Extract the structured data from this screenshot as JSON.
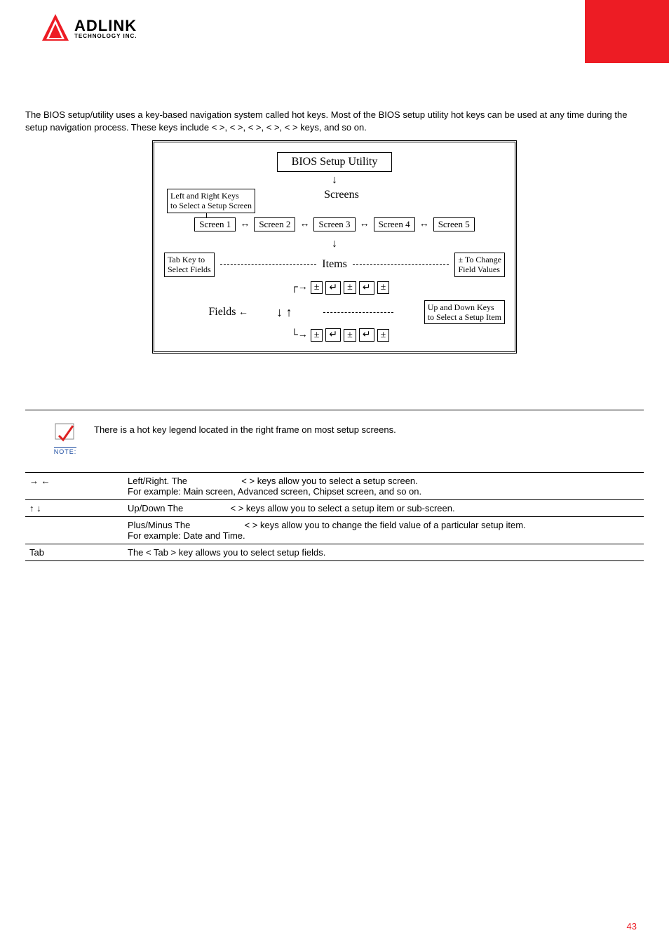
{
  "logo": {
    "line1": "ADLINK",
    "line2": "TECHNOLOGY INC."
  },
  "intro": "The BIOS setup/utility uses a key-based navigation system called hot keys. Most of the BIOS setup utility hot keys can be used at any time during the setup navigation process. These keys include <      >, <      >, <            >, <      >, <            > keys, and so on.",
  "diagram": {
    "title": "BIOS Setup Utility",
    "lr_label_l1": "Left and Right Keys",
    "lr_label_l2": "to Select a Setup Screen",
    "screens_label": "Screens",
    "screens": [
      "Screen 1",
      "Screen 2",
      "Screen 3",
      "Screen 4",
      "Screen 5"
    ],
    "tab_label_l1": "Tab Key to",
    "tab_label_l2": "Select Fields",
    "items_label": "Items",
    "change_label_l1": "± To Change",
    "change_label_l2": "Field Values",
    "fields_label": "Fields",
    "updown_label_l1": "Up and Down Keys",
    "updown_label_l2": "to Select a Setup Item"
  },
  "note": {
    "caption": "NOTE:",
    "text": "There is a hot key legend located in the right frame on most setup screens."
  },
  "keys": {
    "lr": {
      "sym": "→ ←",
      "l1a": "Left/Right. The ",
      "l1b": "<           >",
      "l1c": " keys allow you to select a setup screen.",
      "l2": "For example: Main screen, Advanced screen, Chipset screen, and so on."
    },
    "ud": {
      "sym": "↑  ↓",
      "a": "Up/Down The ",
      "b": "<         >",
      "c": " keys allow you to select a setup item or sub-screen."
    },
    "pm": {
      "sym": "",
      "a": "Plus/Minus The ",
      "b": "<           >",
      "c": " keys allow you to change the field value of a particular setup item.",
      "l2": "For example: Date and Time."
    },
    "tab": {
      "sym": "Tab",
      "text": "The < Tab > key allows you to select setup fields."
    }
  },
  "page_number": "43"
}
